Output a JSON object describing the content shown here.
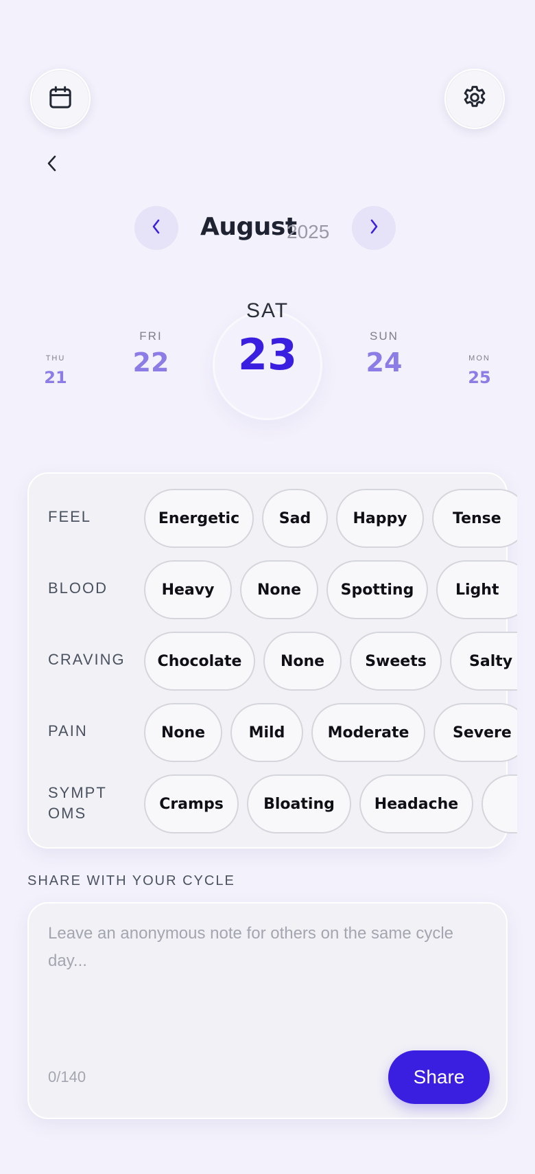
{
  "header": {
    "calendar_icon": "calendar-icon",
    "settings_icon": "gear-icon",
    "back_icon": "chevron-left-icon"
  },
  "month_nav": {
    "month": "August",
    "year": "2025"
  },
  "days": [
    {
      "dow": "THU",
      "num": "21"
    },
    {
      "dow": "FRI",
      "num": "22"
    },
    {
      "dow": "SAT",
      "num": "23",
      "selected": true
    },
    {
      "dow": "SUN",
      "num": "24"
    },
    {
      "dow": "MON",
      "num": "25"
    }
  ],
  "tracker": {
    "rows": [
      {
        "label": "FEEL",
        "chips": [
          "Energetic",
          "Sad",
          "Happy",
          "Tense"
        ]
      },
      {
        "label": "BLOOD",
        "chips": [
          "Heavy",
          "None",
          "Spotting",
          "Light"
        ]
      },
      {
        "label": "CRAVING",
        "chips": [
          "Chocolate",
          "None",
          "Sweets",
          "Salty"
        ]
      },
      {
        "label": "PAIN",
        "chips": [
          "None",
          "Mild",
          "Moderate",
          "Severe"
        ]
      },
      {
        "label": "SYMPTOMS",
        "chips": [
          "Cramps",
          "Bloating",
          "Headache",
          ""
        ]
      }
    ]
  },
  "share": {
    "section_label": "SHARE WITH YOUR CYCLE",
    "placeholder": "Leave an anonymous note for others on the same cycle day...",
    "counter": "0/140",
    "button_label": "Share"
  },
  "colors": {
    "accent": "#3b1fe0",
    "accent_light": "#8c7de6",
    "background": "#f3f1fb"
  }
}
